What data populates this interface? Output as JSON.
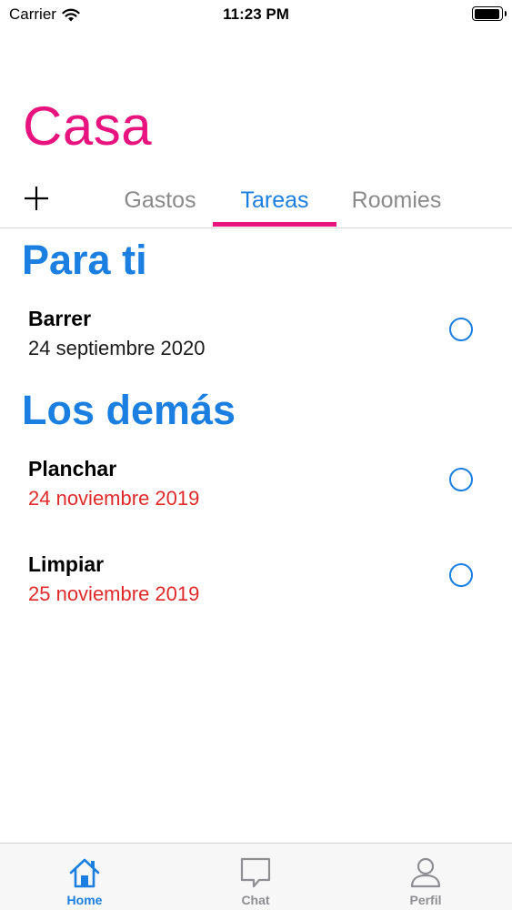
{
  "status_bar": {
    "carrier": "Carrier",
    "time": "11:23 PM",
    "battery_level": 0.95
  },
  "header": {
    "title": "Casa"
  },
  "tabs": [
    {
      "label": "Gastos",
      "active": false
    },
    {
      "label": "Tareas",
      "active": true
    },
    {
      "label": "Roomies",
      "active": false
    }
  ],
  "sections": [
    {
      "title": "Para ti",
      "tasks": [
        {
          "name": "Barrer",
          "date": "24 septiembre 2020",
          "overdue": false
        }
      ]
    },
    {
      "title": "Los demás",
      "tasks": [
        {
          "name": "Planchar",
          "date": "24 noviembre 2019",
          "overdue": true
        },
        {
          "name": "Limpiar",
          "date": "25 noviembre 2019",
          "overdue": true
        }
      ]
    }
  ],
  "tab_bar": [
    {
      "label": "Home",
      "icon": "home-icon",
      "active": true
    },
    {
      "label": "Chat",
      "icon": "chat-icon",
      "active": false
    },
    {
      "label": "Perfil",
      "icon": "person-icon",
      "active": false
    }
  ],
  "colors": {
    "accent_pink": "#e8137f",
    "accent_blue": "#1a7fe0",
    "overdue_red": "#e02a2a",
    "inactive_gray": "#8e8e93"
  }
}
